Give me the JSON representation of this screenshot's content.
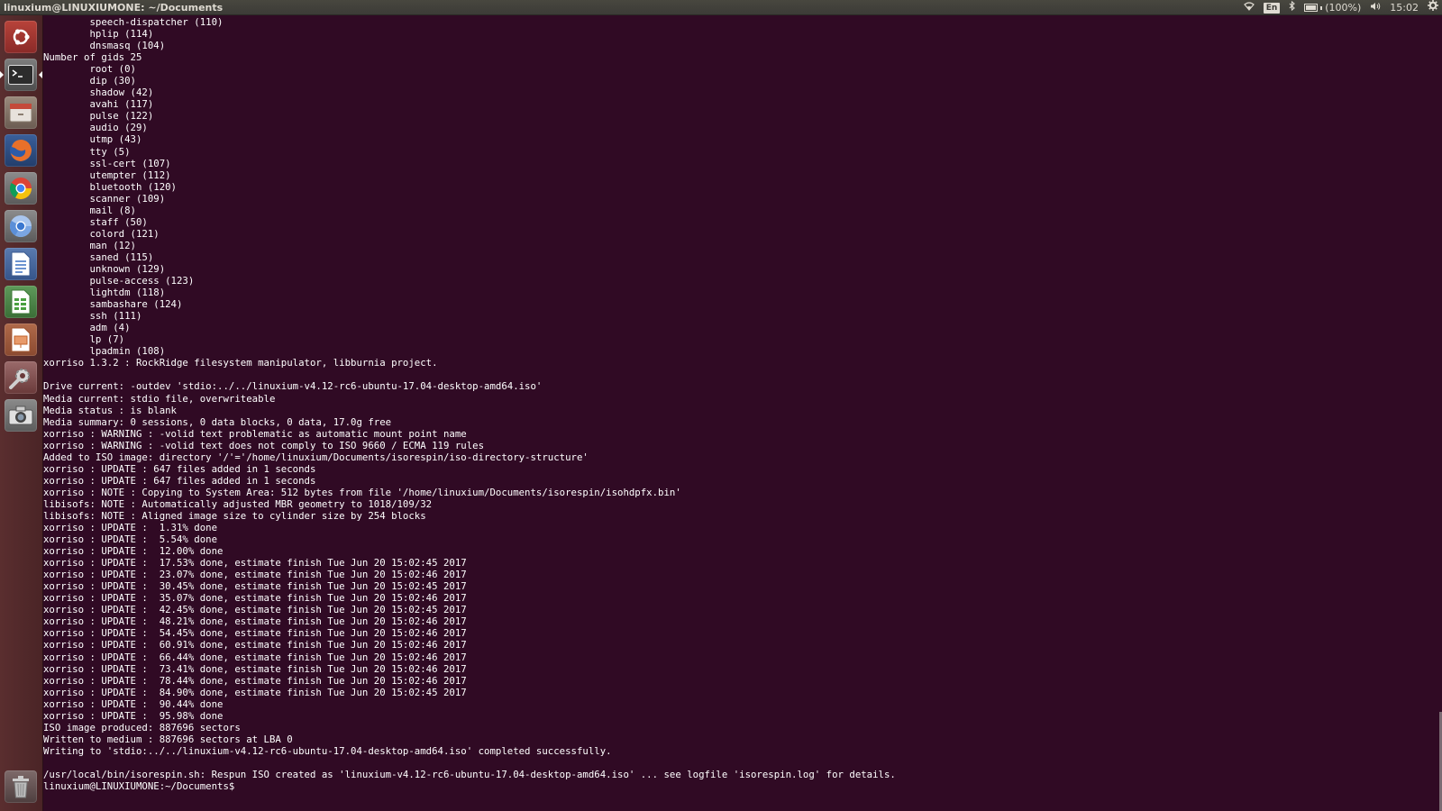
{
  "window": {
    "title": "linuxium@LINUXIUMONE: ~/Documents"
  },
  "indicators": {
    "keyboard": "En",
    "battery_text": "(100%)",
    "battery_level": 1.0,
    "time": "15:02"
  },
  "launcher": {
    "items": [
      {
        "name": "dash-home-button",
        "icon": "ubuntu-logo-icon"
      },
      {
        "name": "terminal-launcher",
        "icon": "terminal-icon",
        "active": true
      },
      {
        "name": "files-launcher",
        "icon": "file-cabinet-icon"
      },
      {
        "name": "firefox-launcher",
        "icon": "firefox-icon"
      },
      {
        "name": "chrome-launcher",
        "icon": "chrome-icon"
      },
      {
        "name": "chromium-launcher",
        "icon": "chromium-icon"
      },
      {
        "name": "writer-launcher",
        "icon": "document-icon"
      },
      {
        "name": "calc-launcher",
        "icon": "spreadsheet-icon"
      },
      {
        "name": "impress-launcher",
        "icon": "presentation-icon"
      },
      {
        "name": "settings-launcher",
        "icon": "wrench-gear-icon"
      },
      {
        "name": "camera-launcher",
        "icon": "camera-icon"
      },
      {
        "name": "trash-launcher",
        "icon": "trash-icon"
      }
    ]
  },
  "terminal": {
    "lines": [
      "        speech-dispatcher (110)",
      "        hplip (114)",
      "        dnsmasq (104)",
      "Number of gids 25",
      "        root (0)",
      "        dip (30)",
      "        shadow (42)",
      "        avahi (117)",
      "        pulse (122)",
      "        audio (29)",
      "        utmp (43)",
      "        tty (5)",
      "        ssl-cert (107)",
      "        utempter (112)",
      "        bluetooth (120)",
      "        scanner (109)",
      "        mail (8)",
      "        staff (50)",
      "        colord (121)",
      "        man (12)",
      "        saned (115)",
      "        unknown (129)",
      "        pulse-access (123)",
      "        lightdm (118)",
      "        sambashare (124)",
      "        ssh (111)",
      "        adm (4)",
      "        lp (7)",
      "        lpadmin (108)",
      "xorriso 1.3.2 : RockRidge filesystem manipulator, libburnia project.",
      "",
      "Drive current: -outdev 'stdio:../../linuxium-v4.12-rc6-ubuntu-17.04-desktop-amd64.iso'",
      "Media current: stdio file, overwriteable",
      "Media status : is blank",
      "Media summary: 0 sessions, 0 data blocks, 0 data, 17.0g free",
      "xorriso : WARNING : -volid text problematic as automatic mount point name",
      "xorriso : WARNING : -volid text does not comply to ISO 9660 / ECMA 119 rules",
      "Added to ISO image: directory '/'='/home/linuxium/Documents/isorespin/iso-directory-structure'",
      "xorriso : UPDATE : 647 files added in 1 seconds",
      "xorriso : UPDATE : 647 files added in 1 seconds",
      "xorriso : NOTE : Copying to System Area: 512 bytes from file '/home/linuxium/Documents/isorespin/isohdpfx.bin'",
      "libisofs: NOTE : Automatically adjusted MBR geometry to 1018/109/32",
      "libisofs: NOTE : Aligned image size to cylinder size by 254 blocks",
      "xorriso : UPDATE :  1.31% done",
      "xorriso : UPDATE :  5.54% done",
      "xorriso : UPDATE :  12.00% done",
      "xorriso : UPDATE :  17.53% done, estimate finish Tue Jun 20 15:02:45 2017",
      "xorriso : UPDATE :  23.07% done, estimate finish Tue Jun 20 15:02:46 2017",
      "xorriso : UPDATE :  30.45% done, estimate finish Tue Jun 20 15:02:45 2017",
      "xorriso : UPDATE :  35.07% done, estimate finish Tue Jun 20 15:02:46 2017",
      "xorriso : UPDATE :  42.45% done, estimate finish Tue Jun 20 15:02:45 2017",
      "xorriso : UPDATE :  48.21% done, estimate finish Tue Jun 20 15:02:46 2017",
      "xorriso : UPDATE :  54.45% done, estimate finish Tue Jun 20 15:02:46 2017",
      "xorriso : UPDATE :  60.91% done, estimate finish Tue Jun 20 15:02:46 2017",
      "xorriso : UPDATE :  66.44% done, estimate finish Tue Jun 20 15:02:46 2017",
      "xorriso : UPDATE :  73.41% done, estimate finish Tue Jun 20 15:02:46 2017",
      "xorriso : UPDATE :  78.44% done, estimate finish Tue Jun 20 15:02:46 2017",
      "xorriso : UPDATE :  84.90% done, estimate finish Tue Jun 20 15:02:45 2017",
      "xorriso : UPDATE :  90.44% done",
      "xorriso : UPDATE :  95.98% done",
      "ISO image produced: 887696 sectors",
      "Written to medium : 887696 sectors at LBA 0",
      "Writing to 'stdio:../../linuxium-v4.12-rc6-ubuntu-17.04-desktop-amd64.iso' completed successfully.",
      "",
      "/usr/local/bin/isorespin.sh: Respun ISO created as 'linuxium-v4.12-rc6-ubuntu-17.04-desktop-amd64.iso' ... see logfile 'isorespin.log' for details.",
      "linuxium@LINUXIUMONE:~/Documents$ "
    ]
  }
}
